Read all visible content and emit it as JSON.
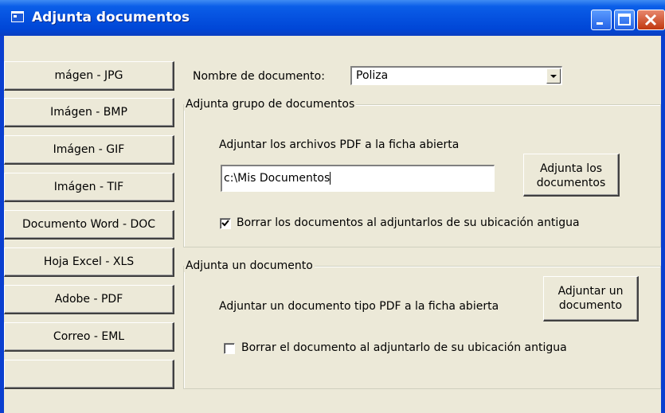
{
  "window": {
    "title": "Adjunta documentos"
  },
  "left_buttons": [
    "mágen - JPG",
    "Imágen - BMP",
    "Imágen - GIF",
    "Imágen - TIF",
    "Documento Word - DOC",
    "Hoja Excel - XLS",
    "Adobe - PDF",
    "Correo - EML",
    ""
  ],
  "doc_name": {
    "label": "Nombre de documento:",
    "value": "Poliza"
  },
  "group_batch": {
    "legend": "Adjunta grupo de documentos",
    "description": "Adjuntar los archivos PDF a la ficha abierta",
    "path_value": "c:\\Mis Documentos",
    "button_line1": "Adjunta los",
    "button_line2": "documentos",
    "checkbox_label": "Borrar los documentos al adjuntarlos de su ubicación antigua",
    "checkbox_checked": true
  },
  "group_single": {
    "legend": "Adjunta un documento",
    "description": "Adjuntar un documento tipo PDF a la ficha abierta",
    "button_line1": "Adjuntar un",
    "button_line2": "documento",
    "checkbox_label": "Borrar el documento al adjuntarlo de su ubicación antigua",
    "checkbox_checked": false
  }
}
